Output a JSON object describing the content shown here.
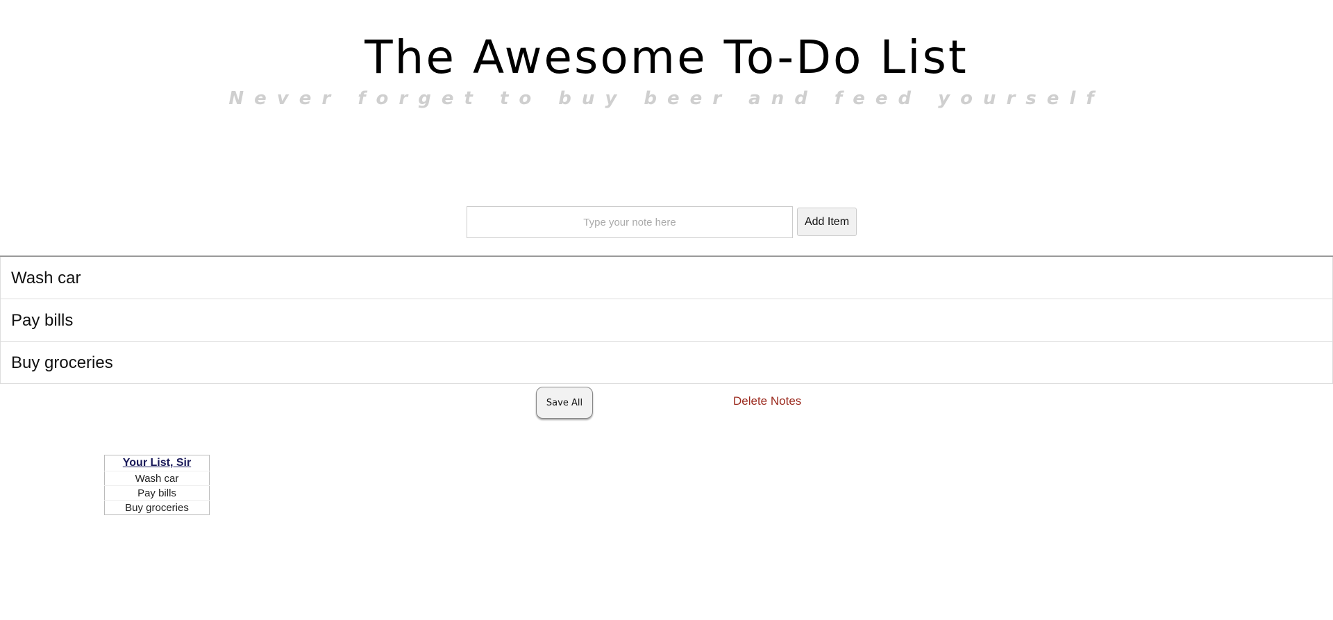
{
  "header": {
    "title": "The Awesome To-Do List",
    "subtitle": "Never forget to buy beer and feed yourself"
  },
  "entry": {
    "placeholder": "Type your note here",
    "value": "",
    "add_label": "Add Item"
  },
  "todos": [
    {
      "label": "Wash car"
    },
    {
      "label": "Pay bills"
    },
    {
      "label": "Buy groceries"
    }
  ],
  "actions": {
    "save_label": "Save All",
    "delete_label": "Delete Notes",
    "delete_color": "#9b2a1e"
  },
  "summary": {
    "heading": "Your List, Sir",
    "rows": [
      "Wash car",
      "Pay bills",
      "Buy groceries"
    ]
  }
}
